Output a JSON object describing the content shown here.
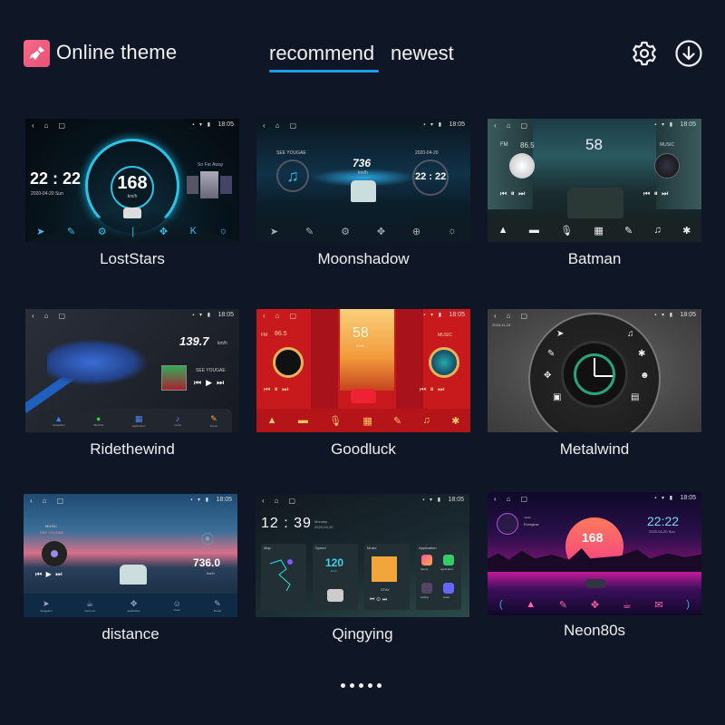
{
  "header": {
    "app_title": "Online theme",
    "logo_icon": "paint-brush-icon",
    "tabs": [
      {
        "label": "recommend",
        "active": true
      },
      {
        "label": "newest",
        "active": false
      }
    ],
    "accent_color": "#1e9be6",
    "actions": [
      {
        "icon": "gear-icon",
        "label": "settings"
      },
      {
        "icon": "download-icon",
        "label": "download"
      }
    ]
  },
  "themes": [
    {
      "name": "LostStars",
      "preview": {
        "status_time": "18:05",
        "clock": "22 : 22",
        "date": "2020-04-20   Sun",
        "speed": "168",
        "speed_unit": "km/h",
        "song": "So Far Away"
      }
    },
    {
      "name": "Moonshadow",
      "preview": {
        "status_time": "18:05",
        "artist": "SEE YOUGAE",
        "speed": "736",
        "speed_unit": "km/h",
        "date": "2020-04-20",
        "clock": "22 : 22"
      }
    },
    {
      "name": "Batman",
      "preview": {
        "status_time": "18:05",
        "radio_band": "FM",
        "frequency": "86.5",
        "speed": "58",
        "music_label": "MUSIC"
      }
    },
    {
      "name": "Ridethewind",
      "preview": {
        "status_time": "18:05",
        "speed": "139.7",
        "speed_unit": "km/h",
        "artist": "SEE YOUGAE",
        "dock": [
          "navigation",
          "WeChat",
          "application",
          "music",
          "theme"
        ]
      }
    },
    {
      "name": "Goodluck",
      "preview": {
        "status_time": "18:05",
        "radio_band": "FM",
        "frequency": "86.5",
        "speed": "58",
        "speed_unit": "Km/h",
        "music_label": "MUSIC"
      }
    },
    {
      "name": "Metalwind",
      "preview": {
        "status_time": "18:05",
        "date": "2018-11-23"
      }
    },
    {
      "name": "distance",
      "preview": {
        "status_time": "18:05",
        "music_label": "MUSIC",
        "artist": "SEE YOUGAE",
        "distance": "736.0",
        "distance_unit": "km/h",
        "dock": [
          "navigation",
          "Cool me",
          "application",
          "Kuwo",
          "theme"
        ]
      }
    },
    {
      "name": "Qingying",
      "preview": {
        "status_time": "18:05",
        "clock": "12 : 39",
        "day": "Monday",
        "date": "2020-04-20",
        "widgets": [
          "Map",
          "Speed",
          "Music",
          "Application"
        ],
        "speed": "120",
        "speed_unit": "km/h",
        "song": "STAY",
        "apps": [
          "theme",
          "application",
          "setting",
          "video"
        ]
      }
    },
    {
      "name": "Neon80s",
      "preview": {
        "status_time": "18:05",
        "music_label": "music",
        "song": "Everglow",
        "speed": "168",
        "clock": "22:22",
        "date": "2020-04-20  Sun"
      }
    }
  ],
  "pagination": {
    "total_pages": 5,
    "current_page": 1
  }
}
